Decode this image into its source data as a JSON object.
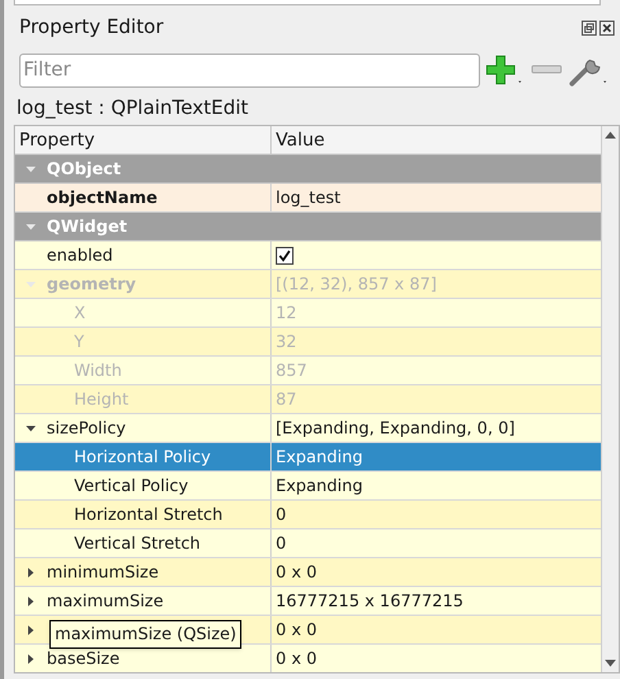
{
  "panel": {
    "title": "Property Editor"
  },
  "filter": {
    "placeholder": "Filter"
  },
  "object_label": "log_test : QPlainTextEdit",
  "table": {
    "columns": [
      "Property",
      "Value"
    ],
    "groups": [
      {
        "name": "QObject",
        "expanded": true,
        "rows": [
          {
            "name": "objectName",
            "value": "log_test",
            "modified": true,
            "disabled": false,
            "selected": false
          }
        ]
      },
      {
        "name": "QWidget",
        "expanded": true,
        "rows": [
          {
            "name": "enabled",
            "kind": "checkbox",
            "checked": true,
            "modified": false,
            "disabled": false,
            "selected": false
          },
          {
            "name": "geometry",
            "value": "[(12, 32), 857 x 87]",
            "modified": true,
            "disabled": true,
            "selected": false,
            "expanded": true,
            "children": [
              {
                "name": "X",
                "value": "12",
                "disabled": true,
                "selected": false
              },
              {
                "name": "Y",
                "value": "32",
                "disabled": true,
                "selected": false
              },
              {
                "name": "Width",
                "value": "857",
                "disabled": true,
                "selected": false
              },
              {
                "name": "Height",
                "value": "87",
                "disabled": true,
                "selected": false
              }
            ]
          },
          {
            "name": "sizePolicy",
            "value": "[Expanding, Expanding, 0, 0]",
            "modified": false,
            "disabled": false,
            "selected": false,
            "expanded": true,
            "children": [
              {
                "name": "Horizontal Policy",
                "value": "Expanding",
                "disabled": false,
                "selected": true
              },
              {
                "name": "Vertical Policy",
                "value": "Expanding",
                "disabled": false,
                "selected": false
              },
              {
                "name": "Horizontal Stretch",
                "value": "0",
                "disabled": false,
                "selected": false
              },
              {
                "name": "Vertical Stretch",
                "value": "0",
                "disabled": false,
                "selected": false
              }
            ]
          },
          {
            "name": "minimumSize",
            "value": "0 x 0",
            "modified": false,
            "disabled": false,
            "selected": false,
            "expanded": false
          },
          {
            "name": "maximumSize",
            "value": "16777215 x 16777215",
            "modified": false,
            "disabled": false,
            "selected": false,
            "expanded": false
          },
          {
            "value": "0 x 0",
            "selected": false,
            "expanded": false
          },
          {
            "name": "baseSize",
            "value": "0 x 0",
            "modified": false,
            "disabled": false,
            "selected": false,
            "expanded": false
          }
        ]
      }
    ]
  },
  "tooltip": "maximumSize (QSize)"
}
